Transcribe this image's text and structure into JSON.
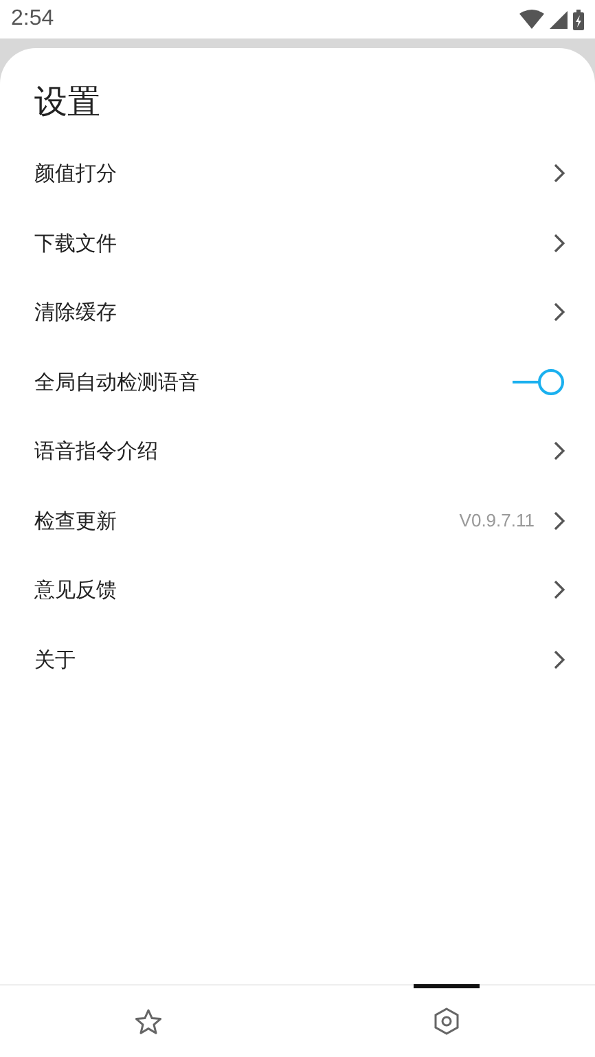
{
  "status_bar": {
    "time": "2:54"
  },
  "title": "设置",
  "items": [
    {
      "kind": "link",
      "label": "颜值打分"
    },
    {
      "kind": "link",
      "label": "下载文件"
    },
    {
      "kind": "link",
      "label": "清除缓存"
    },
    {
      "kind": "toggle",
      "label": "全局自动检测语音",
      "on": true
    },
    {
      "kind": "link",
      "label": "语音指令介绍"
    },
    {
      "kind": "link",
      "label": "检查更新",
      "value": "V0.9.7.11"
    },
    {
      "kind": "link",
      "label": "意见反馈"
    },
    {
      "kind": "link",
      "label": "关于"
    }
  ],
  "bottom_tabs": [
    {
      "kind": "favorites",
      "selected": false
    },
    {
      "kind": "settings",
      "selected": true
    }
  ]
}
